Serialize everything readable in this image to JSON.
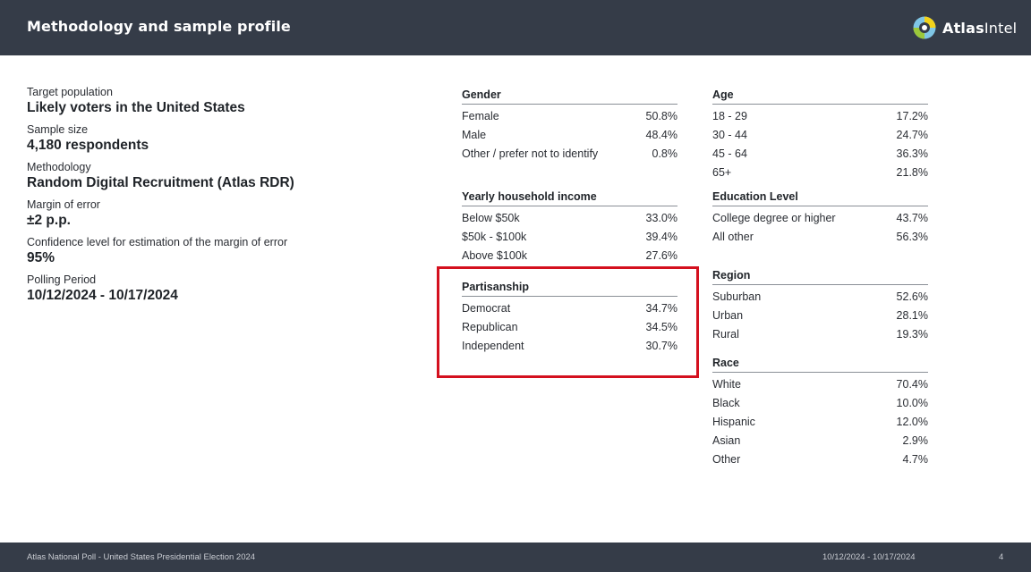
{
  "header": {
    "title": "Methodology and sample profile",
    "logo_text_bold": "Atlas",
    "logo_text_light": "Intel",
    "logo_icon": "atlasintel-logo-icon"
  },
  "methodology": [
    {
      "label": "Target population",
      "value": "Likely voters in the United States"
    },
    {
      "label": "Sample size",
      "value": "4,180 respondents"
    },
    {
      "label": "Methodology",
      "value": "Random Digital Recruitment  (Atlas RDR)"
    },
    {
      "label": "Margin of error",
      "value": "±2 p.p."
    },
    {
      "label": "Confidence level for estimation of the margin of error",
      "value": "95%"
    },
    {
      "label": "Polling Period",
      "value": "10/12/2024 - 10/17/2024"
    }
  ],
  "tables": {
    "gender": {
      "title": "Gender",
      "rows": [
        {
          "label": "Female",
          "value": "50.8%"
        },
        {
          "label": "Male",
          "value": "48.4%"
        },
        {
          "label": "Other / prefer not to identify",
          "value": "0.8%"
        }
      ]
    },
    "income": {
      "title": "Yearly household income",
      "rows": [
        {
          "label": "Below $50k",
          "value": "33.0%"
        },
        {
          "label": "$50k - $100k",
          "value": "39.4%"
        },
        {
          "label": "Above $100k",
          "value": "27.6%"
        }
      ]
    },
    "partisanship": {
      "title": "Partisanship",
      "rows": [
        {
          "label": "Democrat",
          "value": "34.7%"
        },
        {
          "label": "Republican",
          "value": "34.5%"
        },
        {
          "label": "Independent",
          "value": "30.7%"
        }
      ]
    },
    "age": {
      "title": "Age",
      "rows": [
        {
          "label": "18 - 29",
          "value": "17.2%"
        },
        {
          "label": "30 - 44",
          "value": "24.7%"
        },
        {
          "label": "45 - 64",
          "value": "36.3%"
        },
        {
          "label": "65+",
          "value": "21.8%"
        }
      ]
    },
    "education": {
      "title": "Education Level",
      "rows": [
        {
          "label": "College degree or higher",
          "value": "43.7%"
        },
        {
          "label": "All other",
          "value": "56.3%"
        }
      ]
    },
    "region": {
      "title": "Region",
      "rows": [
        {
          "label": "Suburban",
          "value": "52.6%"
        },
        {
          "label": "Urban",
          "value": "28.1%"
        },
        {
          "label": "Rural",
          "value": "19.3%"
        }
      ]
    },
    "race": {
      "title": "Race",
      "rows": [
        {
          "label": "White",
          "value": "70.4%"
        },
        {
          "label": "Black",
          "value": "10.0%"
        },
        {
          "label": "Hispanic",
          "value": "12.0%"
        },
        {
          "label": "Asian",
          "value": "2.9%"
        },
        {
          "label": "Other",
          "value": "4.7%"
        }
      ]
    }
  },
  "highlight_color": "#d4101e",
  "footer": {
    "left": "Atlas National Poll - United States Presidential Election 2024",
    "date": "10/12/2024 - 10/17/2024",
    "page": "4"
  }
}
